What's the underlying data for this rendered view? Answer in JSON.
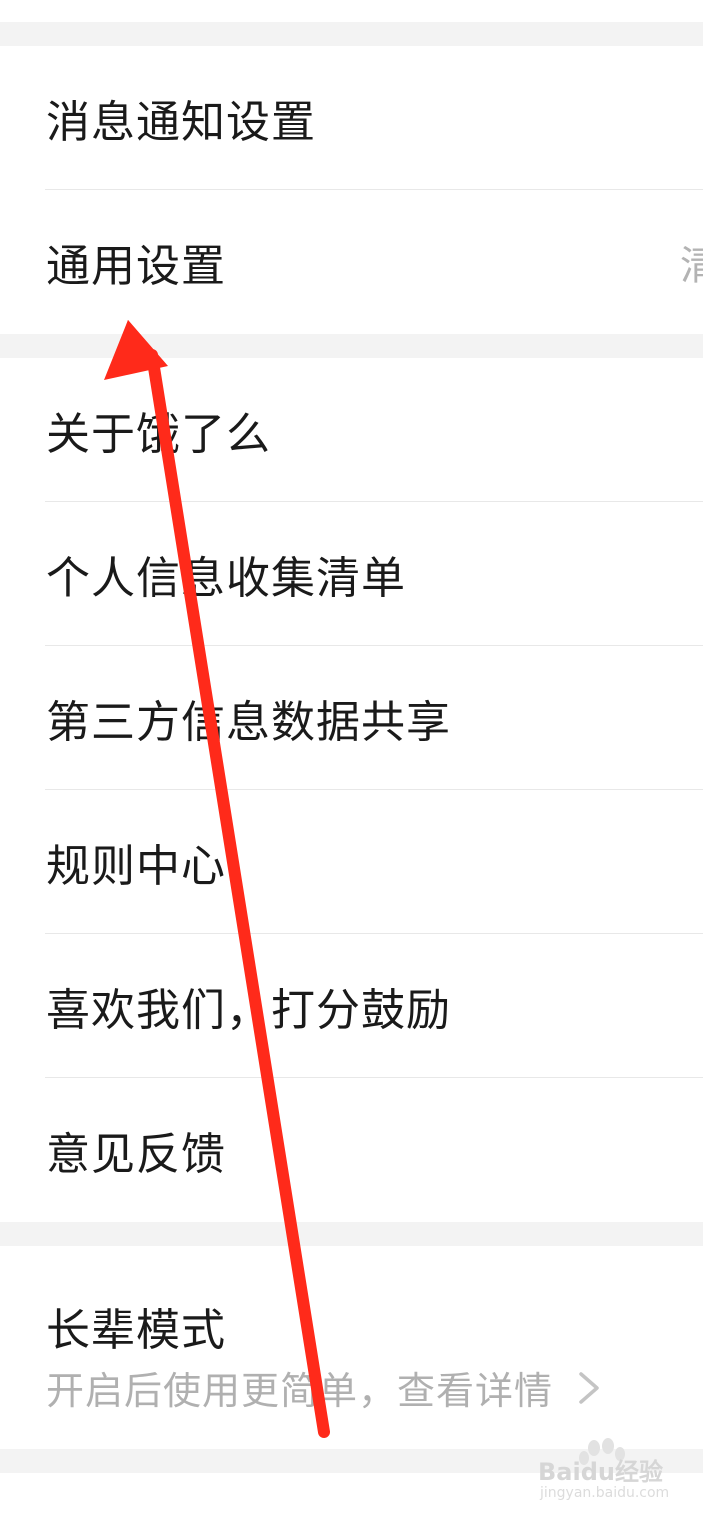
{
  "groups": [
    {
      "items": [
        {
          "label": "消息通知设置"
        },
        {
          "label": "通用设置",
          "trailing": "清"
        }
      ]
    },
    {
      "items": [
        {
          "label": "关于饿了么"
        },
        {
          "label": "个人信息收集清单"
        },
        {
          "label": "第三方信息数据共享"
        },
        {
          "label": "规则中心"
        },
        {
          "label": "喜欢我们，打分鼓励"
        },
        {
          "label": "意见反馈"
        }
      ]
    }
  ],
  "elder_mode": {
    "title": "长辈模式",
    "subtitle": "开启后使用更简单，查看详情",
    "chevron_icon": "chevron-right-icon"
  },
  "annotation": {
    "color": "#ff2a1a",
    "icon": "red-arrow-annotation"
  },
  "watermark": {
    "text": "Baidu经验",
    "sub": "jingyan.baidu.com"
  }
}
